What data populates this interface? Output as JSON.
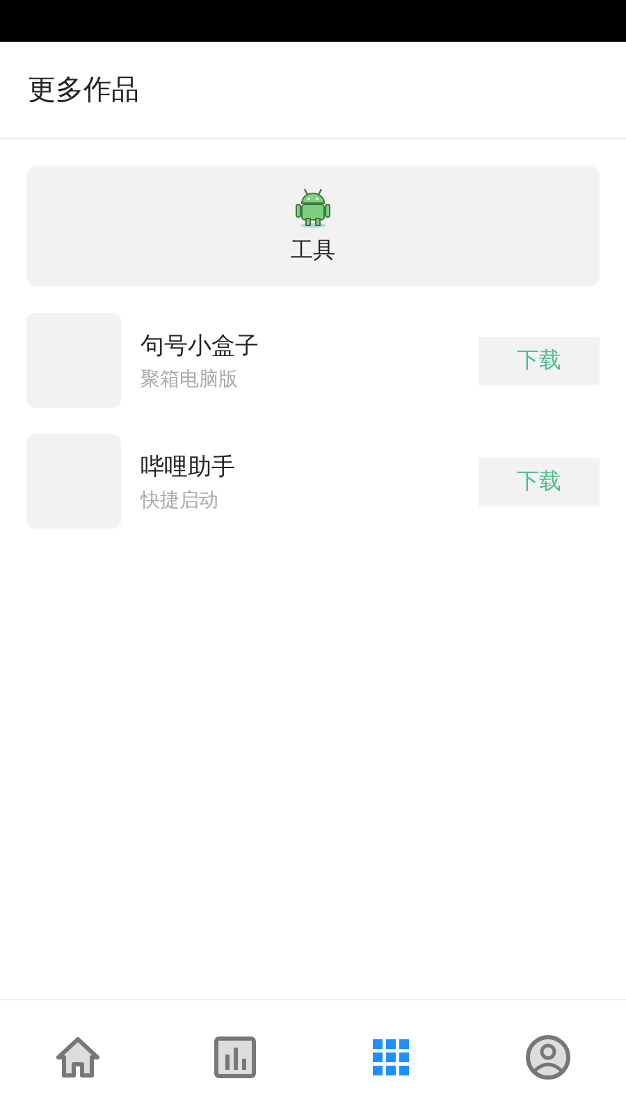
{
  "header": {
    "title": "更多作品"
  },
  "tool_card": {
    "label": "工具"
  },
  "apps": [
    {
      "name": "句号小盒子",
      "subtitle": "聚箱电脑版",
      "action": "下载"
    },
    {
      "name": "哔哩助手",
      "subtitle": "快捷启动",
      "action": "下载"
    }
  ],
  "tabs": [
    {
      "kind": "home",
      "selected": false
    },
    {
      "kind": "chart",
      "selected": false
    },
    {
      "kind": "grid",
      "selected": true
    },
    {
      "kind": "profile",
      "selected": false
    }
  ]
}
